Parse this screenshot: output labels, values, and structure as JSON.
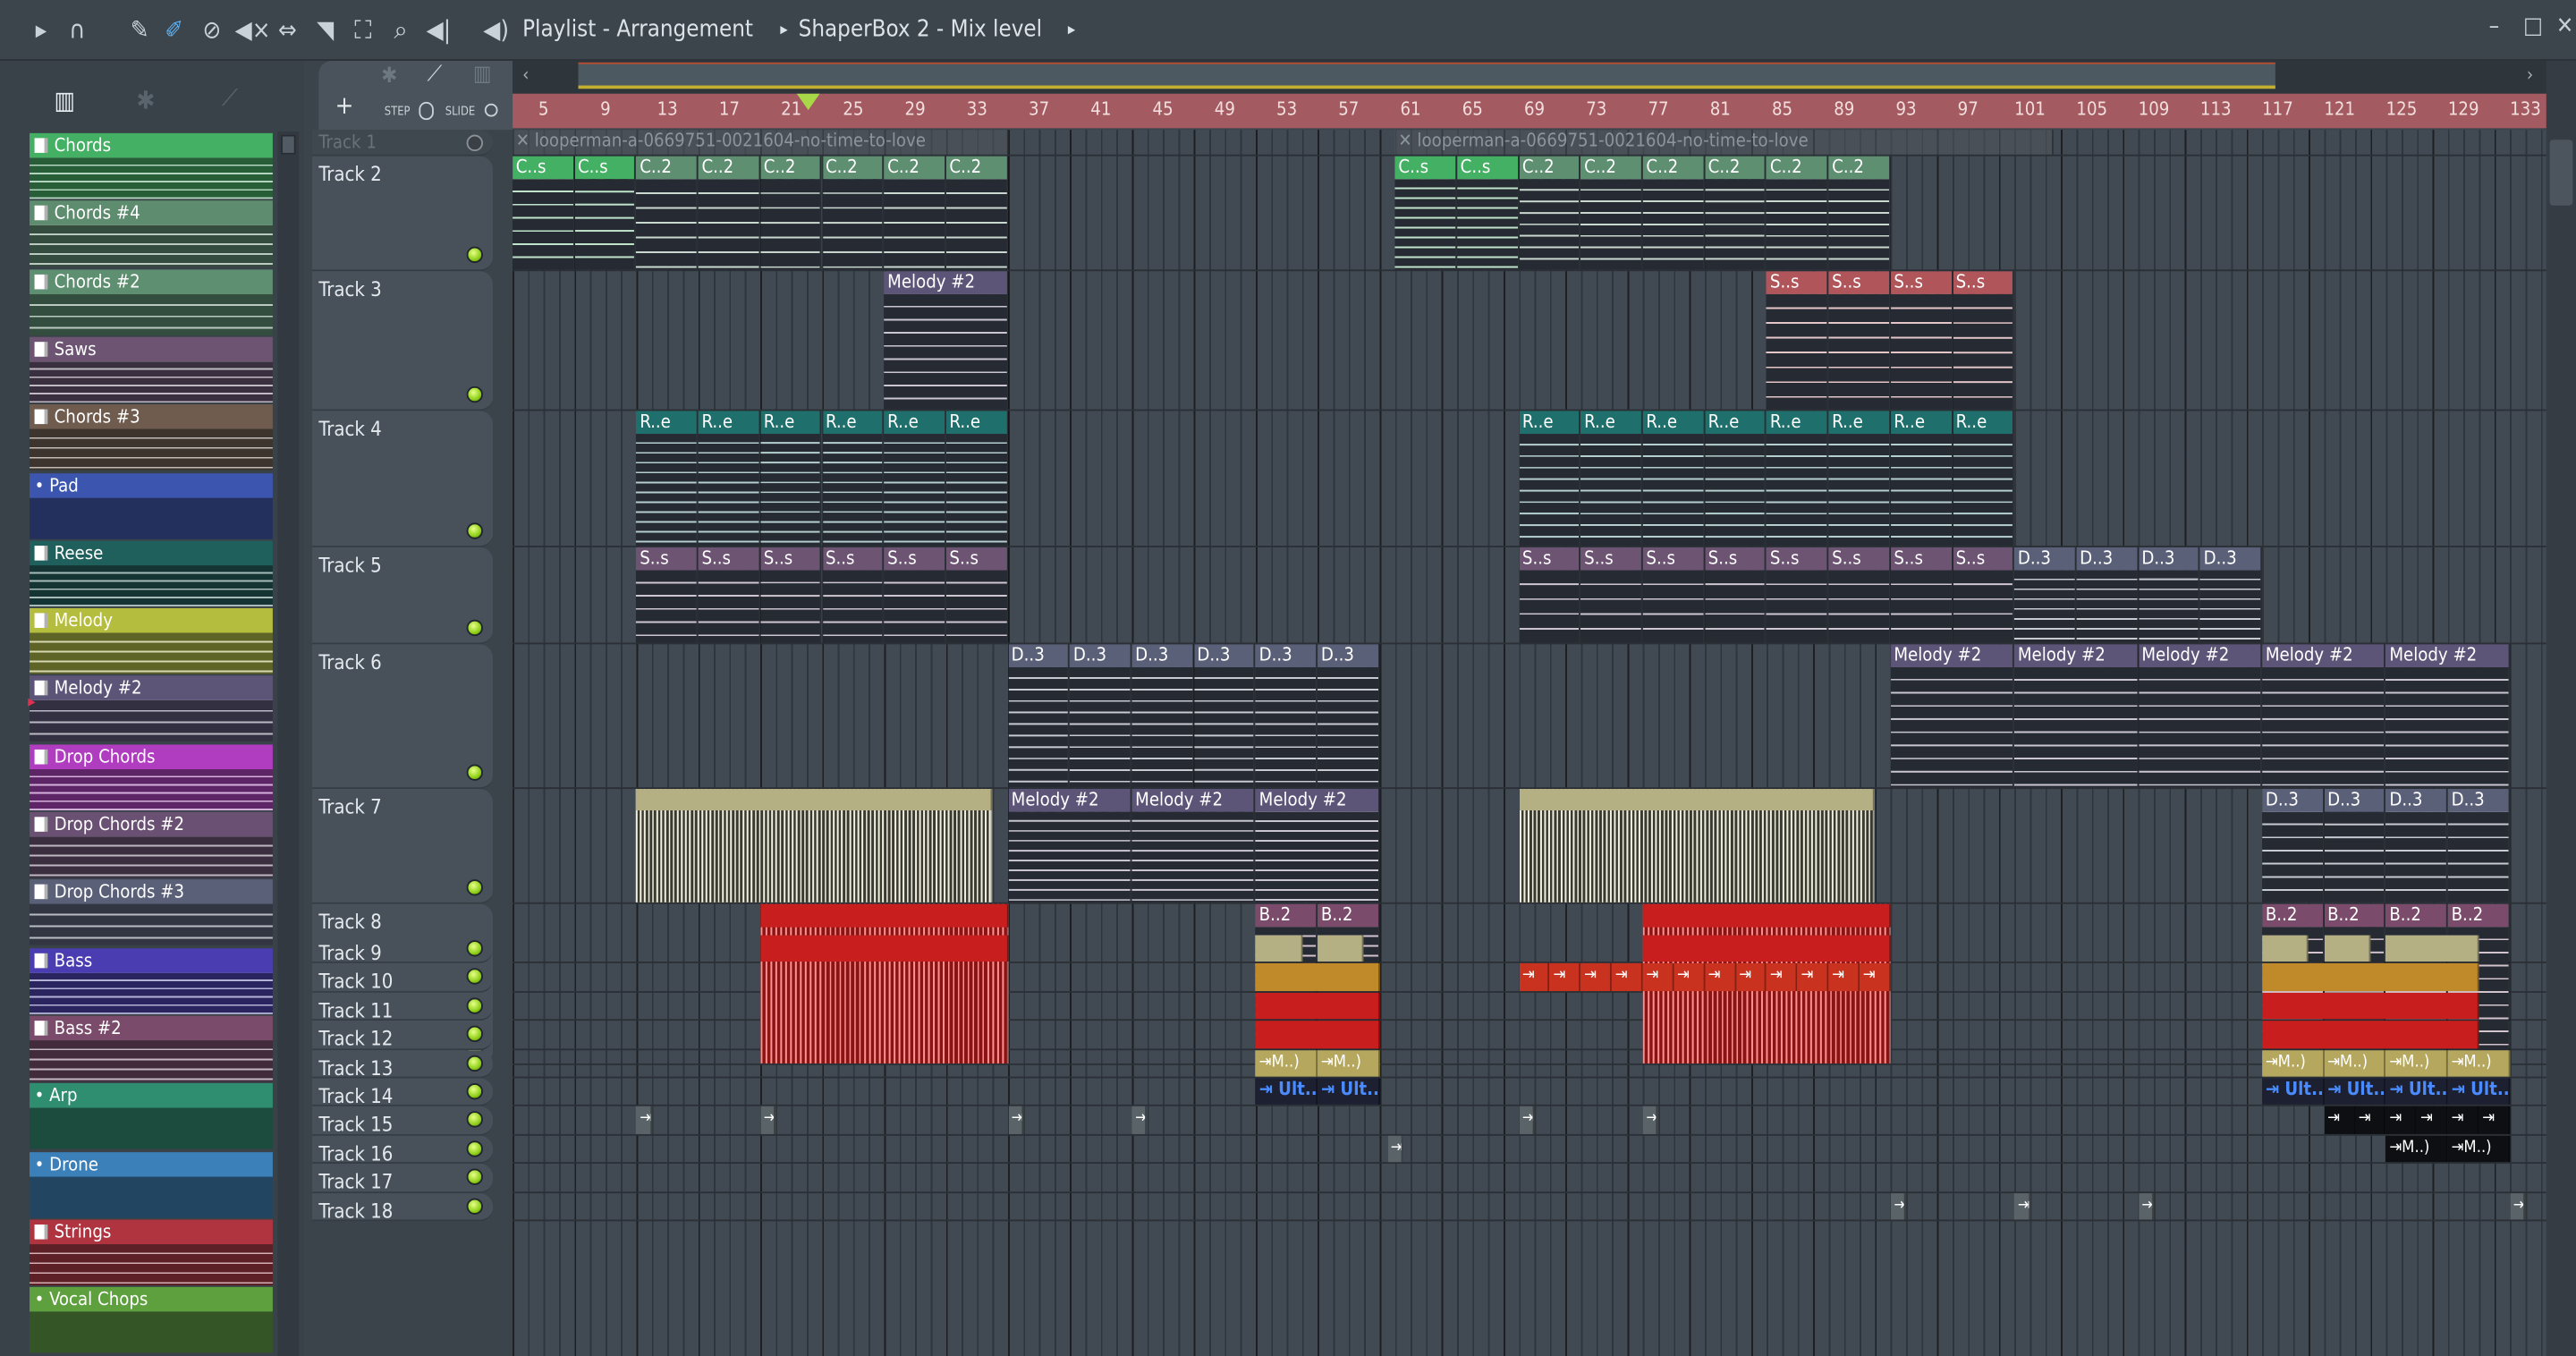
{
  "toolbar": {
    "title": "Playlist - Arrangement",
    "plugin": "ShaperBox 2 - Mix level",
    "icons": [
      "play-arrow-icon",
      "magnet-icon",
      "pencil-icon",
      "paint-brush-icon",
      "delete-icon",
      "mute-icon",
      "slip-icon",
      "slice-icon",
      "select-icon",
      "zoom-icon",
      "playback-icon"
    ]
  },
  "window": {
    "minimize": "–",
    "maximize": "□",
    "close": "✕"
  },
  "controls": {
    "add": "+",
    "step": "STEP",
    "slide": "SLIDE"
  },
  "patterns": [
    {
      "name": "Chords",
      "color": "#43b063",
      "kind": "piano"
    },
    {
      "name": "Chords #4",
      "color": "#5d8d6e",
      "kind": "piano"
    },
    {
      "name": "Chords #2",
      "color": "#5d8f70",
      "kind": "piano"
    },
    {
      "name": "Saws",
      "color": "#6c5472",
      "kind": "piano"
    },
    {
      "name": "Chords #3",
      "color": "#6f5c4e",
      "kind": "piano"
    },
    {
      "name": "Pad",
      "color": "#3c55ae",
      "kind": "dot"
    },
    {
      "name": "Reese",
      "color": "#1f5f5c",
      "kind": "piano"
    },
    {
      "name": "Melody",
      "color": "#b4bd3e",
      "kind": "piano"
    },
    {
      "name": "Melody #2",
      "color": "#5d5578",
      "kind": "piano"
    },
    {
      "name": "Drop Chords",
      "color": "#b03cc0",
      "kind": "piano"
    },
    {
      "name": "Drop Chords #2",
      "color": "#6a5072",
      "kind": "piano"
    },
    {
      "name": "Drop Chords #3",
      "color": "#5b6079",
      "kind": "piano"
    },
    {
      "name": "Bass",
      "color": "#4a3db2",
      "kind": "piano"
    },
    {
      "name": "Bass #2",
      "color": "#7a4b6a",
      "kind": "piano"
    },
    {
      "name": "Arp",
      "color": "#2f8e6f",
      "kind": "dot"
    },
    {
      "name": "Drone",
      "color": "#3b80b8",
      "kind": "dot"
    },
    {
      "name": "Strings",
      "color": "#b03440",
      "kind": "piano"
    },
    {
      "name": "Vocal Chops",
      "color": "#5ea03e",
      "kind": "dot"
    }
  ],
  "tracks": [
    "Track 1",
    "Track 2",
    "Track 3",
    "Track 4",
    "Track 5",
    "Track 6",
    "Track 7",
    "Track 8",
    "Track 9",
    "Track 10",
    "Track 11",
    "Track 12",
    "Track 13",
    "Track 14",
    "Track 15",
    "Track 16",
    "Track 17",
    "Track 18"
  ],
  "ruler": [
    5,
    9,
    13,
    17,
    21,
    25,
    29,
    33,
    37,
    41,
    45,
    49,
    53,
    57,
    61,
    65,
    69,
    73,
    77,
    81,
    85,
    89,
    93,
    97,
    101,
    105,
    109,
    113,
    117,
    121,
    125,
    129,
    133
  ],
  "playhead_bar": 22,
  "clips": [
    {
      "track": 1,
      "start": 3,
      "len": 32,
      "label": "✕ looperman-a-0669751-0021604-no-time-to-love",
      "color": "#4e555c",
      "type": "ghost"
    },
    {
      "track": 1,
      "start": 60,
      "len": 42.5,
      "label": "✕ looperman-a-0669751-0021604-no-time-to-love",
      "color": "#4e555c",
      "type": "ghost"
    },
    {
      "track": 2,
      "start": 3,
      "len": 4,
      "count": 2,
      "label": "C..s",
      "color": "#43b063",
      "type": "notes"
    },
    {
      "track": 2,
      "start": 11,
      "len": 4,
      "count": 6,
      "label": "C..2",
      "color": "#5d8f70",
      "type": "notes"
    },
    {
      "track": 2,
      "start": 60,
      "len": 4,
      "count": 2,
      "label": "C..s",
      "color": "#43b063",
      "type": "notes"
    },
    {
      "track": 2,
      "start": 68,
      "len": 4,
      "count": 6,
      "label": "C..2",
      "color": "#5d8f70",
      "type": "notes"
    },
    {
      "track": 3,
      "start": 27,
      "len": 8,
      "label": "Melody #2",
      "color": "#5d5578",
      "type": "notes"
    },
    {
      "track": 3,
      "start": 84,
      "len": 4,
      "count": 4,
      "label": "S..s",
      "color": "#b0555a",
      "type": "notes"
    },
    {
      "track": 4,
      "start": 11,
      "len": 4,
      "count": 6,
      "label": "R..e",
      "color": "#1f6f6c",
      "type": "notes"
    },
    {
      "track": 4,
      "start": 68,
      "len": 4,
      "count": 8,
      "label": "R..e",
      "color": "#1f6f6c",
      "type": "notes"
    },
    {
      "track": 5,
      "start": 11,
      "len": 4,
      "count": 6,
      "label": "S..s",
      "color": "#6c5472",
      "type": "notes"
    },
    {
      "track": 5,
      "start": 68,
      "len": 4,
      "count": 8,
      "label": "S..s",
      "color": "#6c5472",
      "type": "notes"
    },
    {
      "track": 5,
      "start": 100,
      "len": 4,
      "count": 4,
      "label": "D..3",
      "color": "#5b6079",
      "type": "notes"
    },
    {
      "track": 6,
      "start": 35,
      "len": 4,
      "count": 6,
      "label": "D..3",
      "color": "#5b6079",
      "type": "notes"
    },
    {
      "track": 6,
      "start": 92,
      "len": 8,
      "count": 5,
      "label": "Melody #2",
      "color": "#5d5578",
      "type": "notes"
    },
    {
      "track": 7,
      "start": 11,
      "len": 23,
      "label": "",
      "color": "#b5b084",
      "type": "wave"
    },
    {
      "track": 7,
      "start": 35,
      "len": 8,
      "count": 3,
      "label": "Melody #2",
      "color": "#5d5578",
      "type": "notes"
    },
    {
      "track": 7,
      "start": 68,
      "len": 23,
      "label": "",
      "color": "#b5b084",
      "type": "wave"
    },
    {
      "track": 7,
      "start": 116,
      "len": 4,
      "count": 4,
      "label": "D..3",
      "color": "#5b6079",
      "type": "notes"
    },
    {
      "track": 8,
      "start": 19,
      "len": 16,
      "label": "",
      "color": "#c81e1e",
      "type": "redwave"
    },
    {
      "track": 8,
      "start": 51,
      "len": 4,
      "count": 2,
      "label": "B..2",
      "color": "#7a4b6a",
      "type": "notes"
    },
    {
      "track": 8,
      "start": 76,
      "len": 16,
      "label": "",
      "color": "#c81e1e",
      "type": "redwave"
    },
    {
      "track": 8,
      "start": 116,
      "len": 4,
      "count": 4,
      "label": "B..2",
      "color": "#7a4b6a",
      "type": "notes"
    },
    {
      "track": 9,
      "start": 19,
      "len": 16,
      "label": "",
      "color": "#c81e1e",
      "type": "solid"
    },
    {
      "track": 9,
      "start": 51,
      "len": 3,
      "label": "",
      "color": "#b5b084",
      "type": "solid"
    },
    {
      "track": 9,
      "start": 55,
      "len": 3,
      "label": "",
      "color": "#b5b084",
      "type": "solid"
    },
    {
      "track": 9,
      "start": 76,
      "len": 16,
      "label": "",
      "color": "#c81e1e",
      "type": "solid"
    },
    {
      "track": 9,
      "start": 116,
      "len": 3,
      "label": "",
      "color": "#b5b084",
      "type": "solid"
    },
    {
      "track": 9,
      "start": 120,
      "len": 3,
      "label": "",
      "color": "#b5b084",
      "type": "solid"
    },
    {
      "track": 9,
      "start": 124,
      "len": 6,
      "label": "",
      "color": "#b5b084",
      "type": "solid"
    },
    {
      "track": 10,
      "start": 51,
      "len": 8,
      "label": "",
      "color": "#c08a2a",
      "type": "solid"
    },
    {
      "track": 10,
      "start": 68,
      "len": 2,
      "count": 12,
      "label": "⇥",
      "color": "#c8321e",
      "type": "solid"
    },
    {
      "track": 10,
      "start": 116,
      "len": 14,
      "label": "",
      "color": "#c08a2a",
      "type": "solid"
    },
    {
      "track": 11,
      "start": 51,
      "len": 8,
      "label": "",
      "color": "#c81e1e",
      "type": "solid"
    },
    {
      "track": 11,
      "start": 116,
      "len": 14,
      "label": "",
      "color": "#c81e1e",
      "type": "solid"
    },
    {
      "track": 12,
      "start": 51,
      "len": 8,
      "label": "",
      "color": "#c81e1e",
      "type": "solid"
    },
    {
      "track": 12,
      "start": 116,
      "len": 14,
      "label": "",
      "color": "#c81e1e",
      "type": "solid"
    },
    {
      "track": 13,
      "start": 51,
      "len": 4,
      "count": 2,
      "label": "⇥M..)",
      "color": "#b5a85e",
      "type": "solid"
    },
    {
      "track": 13,
      "start": 116,
      "len": 4,
      "count": 4,
      "label": "⇥M..)",
      "color": "#b5a85e",
      "type": "solid"
    },
    {
      "track": 14,
      "start": 51,
      "len": 4,
      "count": 2,
      "label": "⇥ Ult..",
      "color": "#1c2030",
      "type": "ult"
    },
    {
      "track": 14,
      "start": 116,
      "len": 4,
      "count": 4,
      "label": "⇥ Ult..",
      "color": "#1c2030",
      "type": "ult"
    },
    {
      "track": 15,
      "start": 11,
      "len": 1,
      "label": "⇥",
      "color": "#5a6468",
      "type": "solid"
    },
    {
      "track": 15,
      "start": 19,
      "len": 1,
      "label": "⇥",
      "color": "#5a6468",
      "type": "solid"
    },
    {
      "track": 15,
      "start": 35,
      "len": 1,
      "label": "⇥",
      "color": "#5a6468",
      "type": "solid"
    },
    {
      "track": 15,
      "start": 43,
      "len": 1,
      "label": "⇥",
      "color": "#5a6468",
      "type": "solid"
    },
    {
      "track": 15,
      "start": 68,
      "len": 1,
      "label": "⇥",
      "color": "#5a6468",
      "type": "solid"
    },
    {
      "track": 15,
      "start": 76,
      "len": 1,
      "label": "⇥",
      "color": "#5a6468",
      "type": "solid"
    },
    {
      "track": 15,
      "start": 120,
      "len": 2,
      "count": 6,
      "label": "⇥",
      "color": "#0e0f12",
      "type": "solid"
    },
    {
      "track": 16,
      "start": 59.5,
      "len": 1,
      "label": "⇥",
      "color": "#5a6468",
      "type": "solid"
    },
    {
      "track": 16,
      "start": 124,
      "len": 4,
      "count": 2,
      "label": "⇥M..)",
      "color": "#0e0f12",
      "type": "solid"
    },
    {
      "track": 18,
      "start": 92,
      "len": 1,
      "label": "⇥",
      "color": "#5a6468",
      "type": "solid"
    },
    {
      "track": 18,
      "start": 100,
      "len": 1,
      "label": "⇥",
      "color": "#5a6468",
      "type": "solid"
    },
    {
      "track": 18,
      "start": 108,
      "len": 1,
      "label": "⇥",
      "color": "#5a6468",
      "type": "solid"
    },
    {
      "track": 18,
      "start": 132,
      "len": 1,
      "label": "⇥",
      "color": "#5a6468",
      "type": "solid"
    }
  ]
}
